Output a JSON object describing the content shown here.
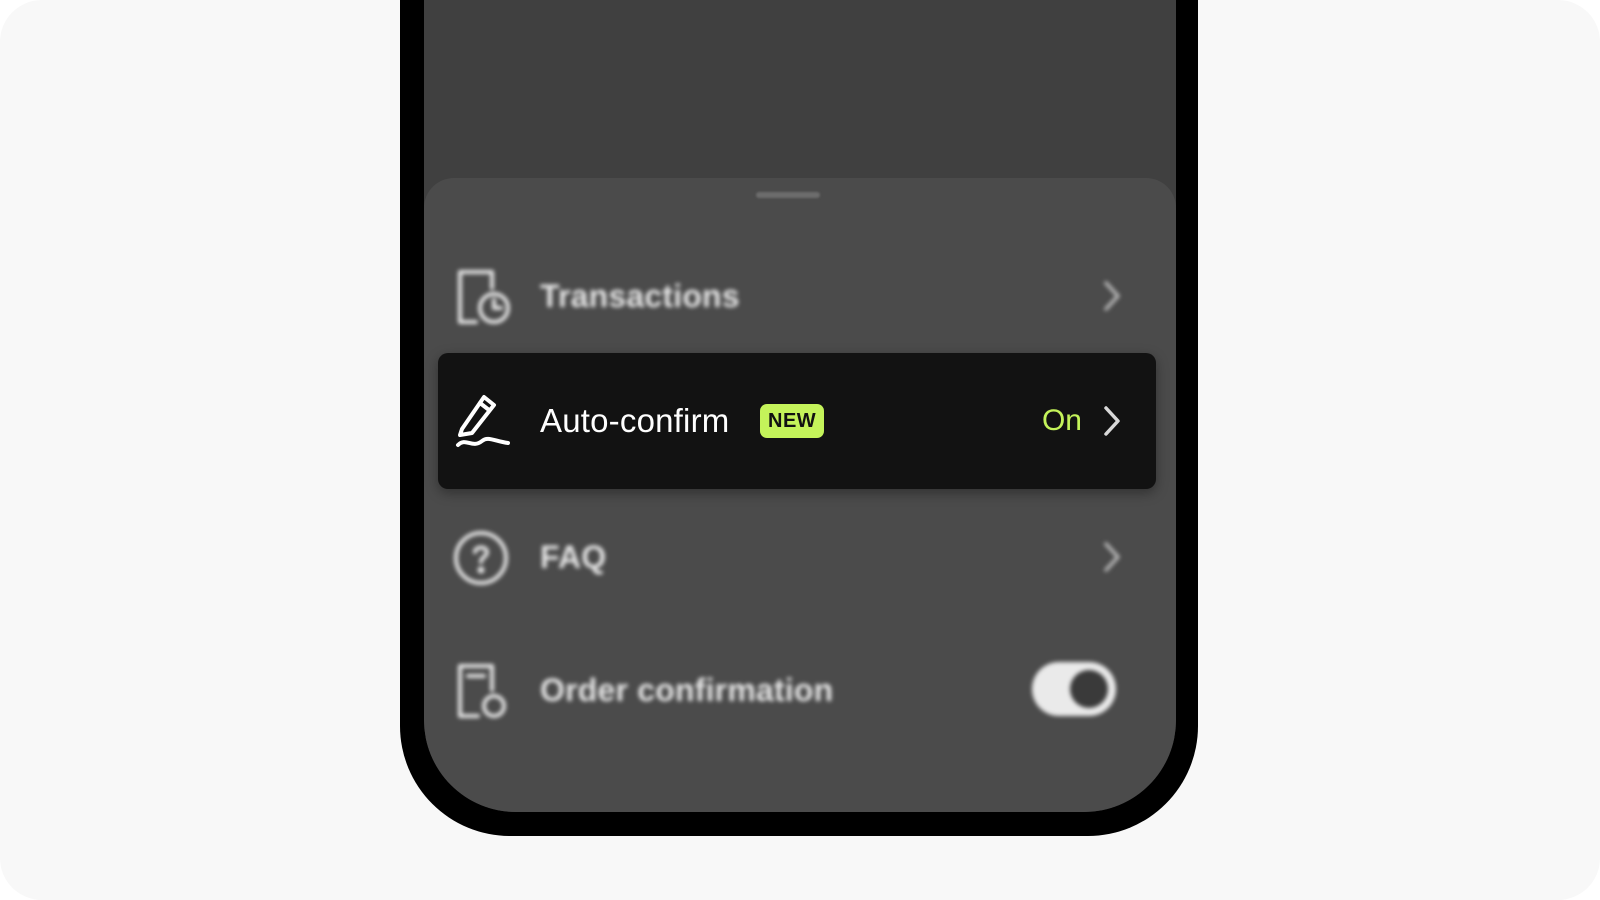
{
  "menu": {
    "items": [
      {
        "label": "Transactions",
        "icon": "transactions-clock-icon"
      },
      {
        "label": "Auto-confirm",
        "icon": "pen-signature-icon",
        "badge": "NEW",
        "status": "On"
      },
      {
        "label": "FAQ",
        "icon": "question-circle-icon"
      },
      {
        "label": "Order confirmation",
        "icon": "order-document-icon",
        "toggle_on": true
      }
    ]
  },
  "colors": {
    "accent": "#c4f35a",
    "sheet": "#4b4b4b",
    "active_row": "#121212",
    "frame": "#000000",
    "stage": "#f8f8f8"
  }
}
